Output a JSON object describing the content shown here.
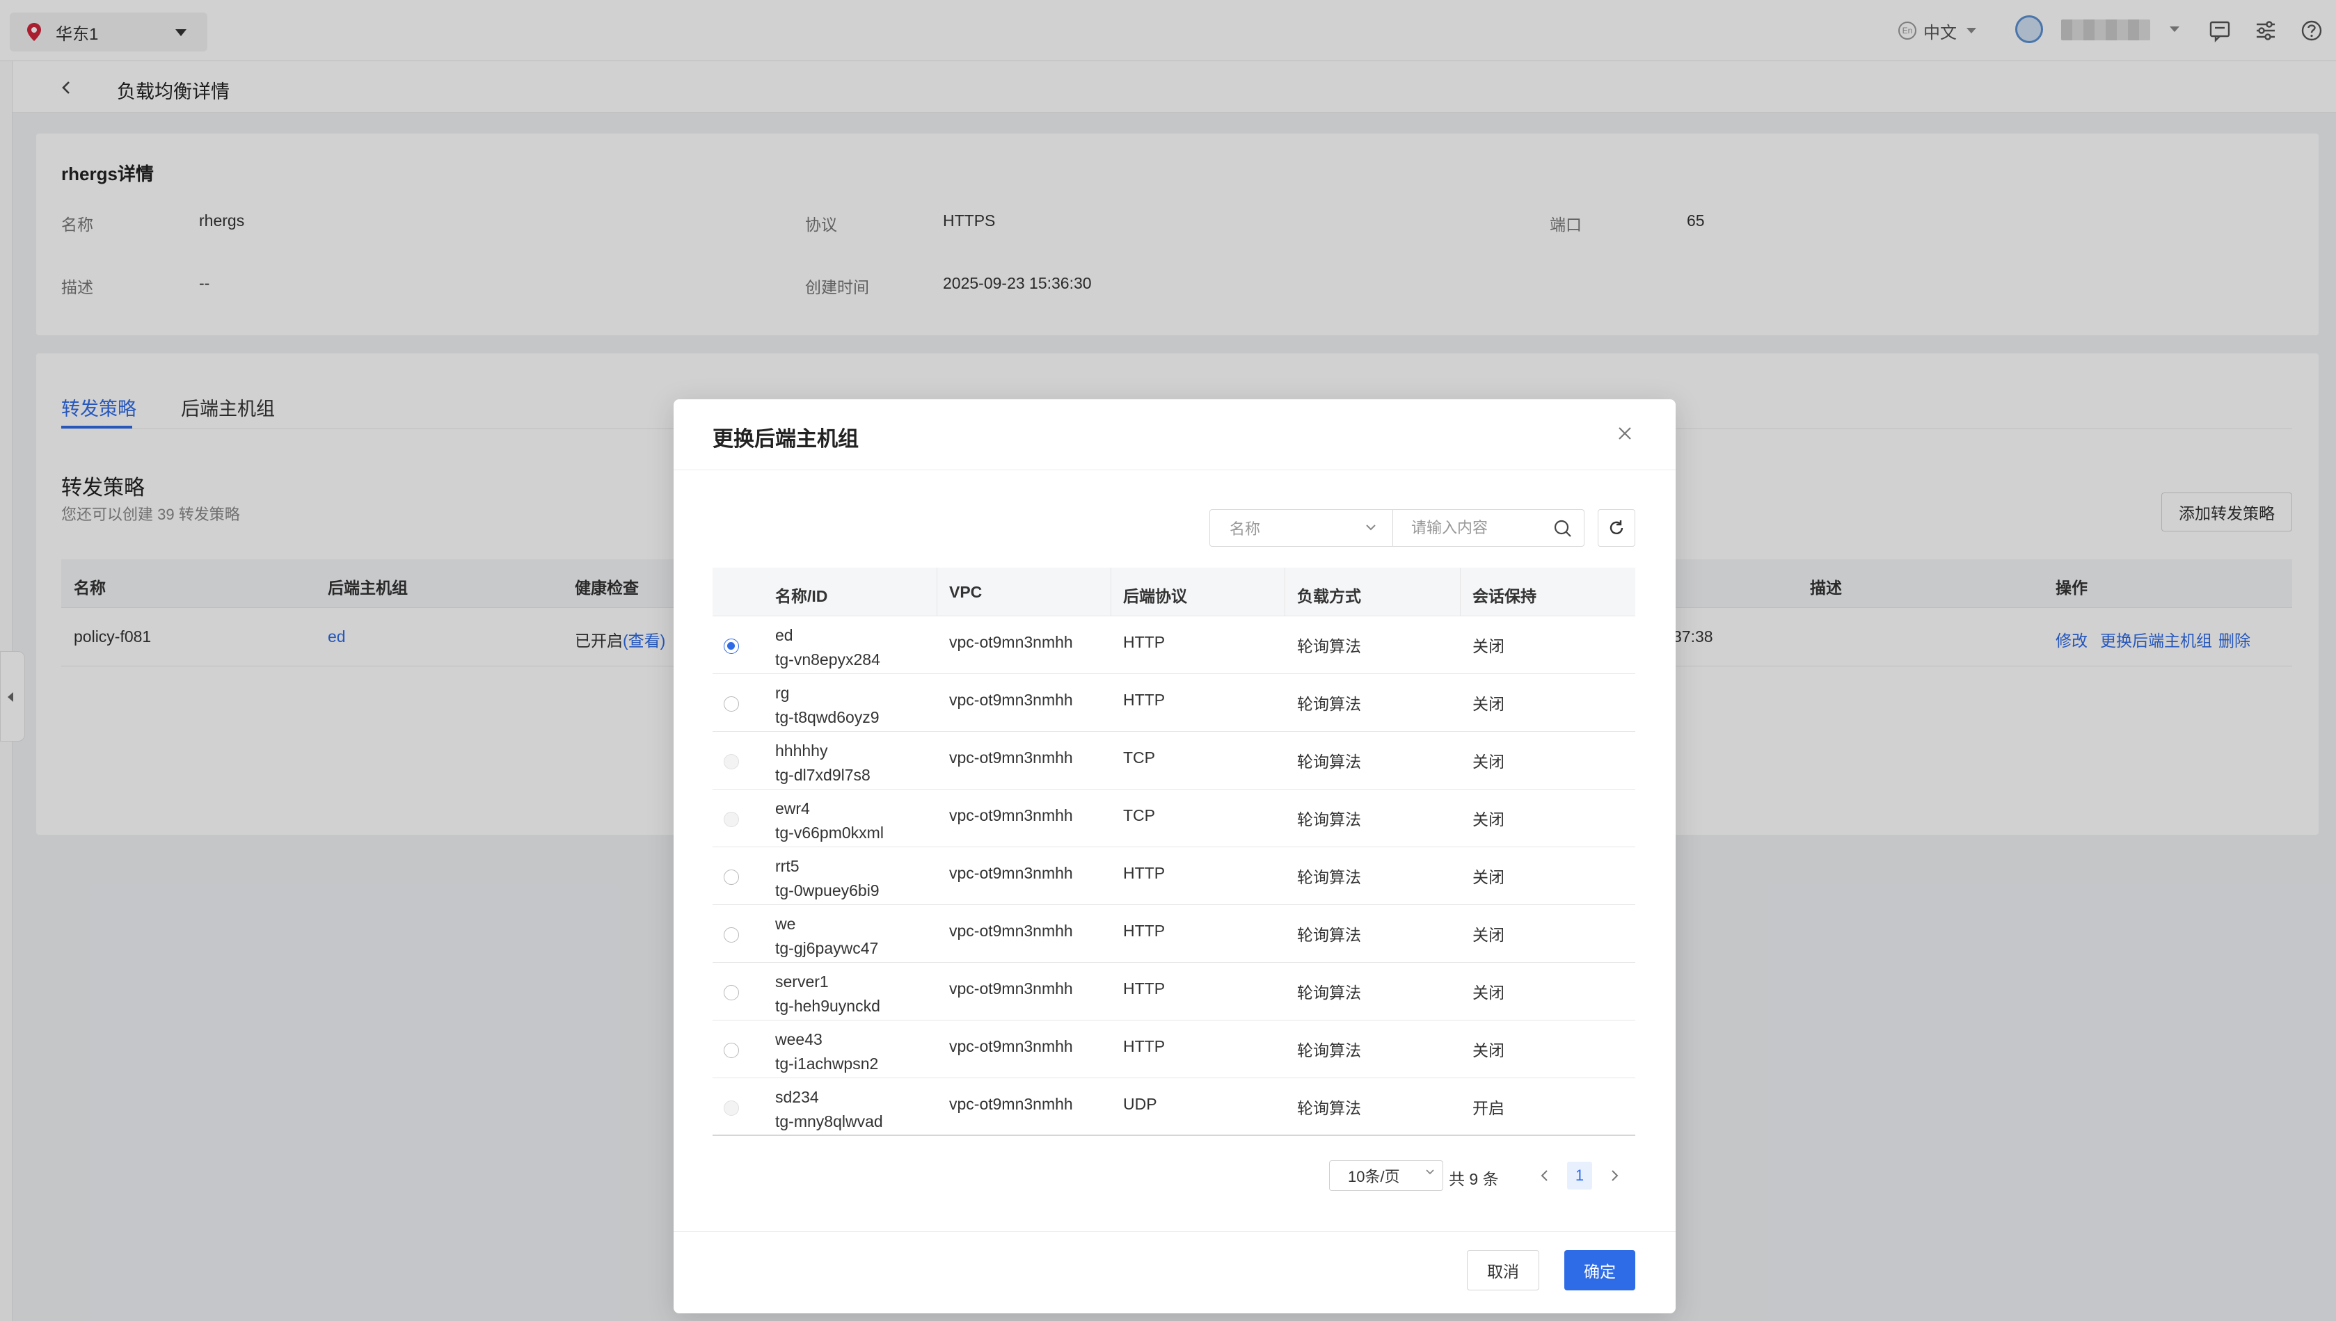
{
  "topbar": {
    "region": "华东1",
    "language": "中文",
    "lang_icon_text": "En"
  },
  "page": {
    "title": "负载均衡详情"
  },
  "detail": {
    "heading": "rhergs详情",
    "name_label": "名称",
    "name_value": "rhergs",
    "protocol_label": "协议",
    "protocol_value": "HTTPS",
    "port_label": "端口",
    "port_value": "65",
    "desc_label": "描述",
    "desc_value": "--",
    "created_label": "创建时间",
    "created_value": "2025-09-23 15:36:30"
  },
  "policy": {
    "tabs": [
      "转发策略",
      "后端主机组"
    ],
    "section_title": "转发策略",
    "section_sub": "您还可以创建 39 转发策略",
    "add_button": "添加转发策略",
    "columns": [
      "名称",
      "后端主机组",
      "健康检查",
      "描述",
      "操作"
    ],
    "row": {
      "name": "policy-f081",
      "group": "ed",
      "health": "已开启",
      "health_link": "(查看)",
      "time_fragment": "37:38",
      "actions": [
        "修改",
        "更换后端主机组",
        "删除"
      ]
    }
  },
  "modal": {
    "title": "更换后端主机组",
    "filter_select": "名称",
    "search_placeholder": "请输入内容",
    "columns": [
      "名称/ID",
      "VPC",
      "后端协议",
      "负载方式",
      "会话保持"
    ],
    "rows": [
      {
        "name": "ed",
        "id": "tg-vn8epyx284",
        "vpc": "vpc-ot9mn3nmhh",
        "protocol": "HTTP",
        "method": "轮询算法",
        "session": "关闭",
        "state": "checked"
      },
      {
        "name": "rg",
        "id": "tg-t8qwd6oyz9",
        "vpc": "vpc-ot9mn3nmhh",
        "protocol": "HTTP",
        "method": "轮询算法",
        "session": "关闭",
        "state": "normal"
      },
      {
        "name": "hhhhhy",
        "id": "tg-dl7xd9l7s8",
        "vpc": "vpc-ot9mn3nmhh",
        "protocol": "TCP",
        "method": "轮询算法",
        "session": "关闭",
        "state": "disabled"
      },
      {
        "name": "ewr4",
        "id": "tg-v66pm0kxml",
        "vpc": "vpc-ot9mn3nmhh",
        "protocol": "TCP",
        "method": "轮询算法",
        "session": "关闭",
        "state": "disabled"
      },
      {
        "name": "rrt5",
        "id": "tg-0wpuey6bi9",
        "vpc": "vpc-ot9mn3nmhh",
        "protocol": "HTTP",
        "method": "轮询算法",
        "session": "关闭",
        "state": "normal"
      },
      {
        "name": "we",
        "id": "tg-gj6paywc47",
        "vpc": "vpc-ot9mn3nmhh",
        "protocol": "HTTP",
        "method": "轮询算法",
        "session": "关闭",
        "state": "normal"
      },
      {
        "name": "server1",
        "id": "tg-heh9uynckd",
        "vpc": "vpc-ot9mn3nmhh",
        "protocol": "HTTP",
        "method": "轮询算法",
        "session": "关闭",
        "state": "normal"
      },
      {
        "name": "wee43",
        "id": "tg-i1achwpsn2",
        "vpc": "vpc-ot9mn3nmhh",
        "protocol": "HTTP",
        "method": "轮询算法",
        "session": "关闭",
        "state": "normal"
      },
      {
        "name": "sd234",
        "id": "tg-mny8qlwvad",
        "vpc": "vpc-ot9mn3nmhh",
        "protocol": "UDP",
        "method": "轮询算法",
        "session": "开启",
        "state": "disabled"
      }
    ],
    "page_size": "10条/页",
    "total": "共 9 条",
    "current_page": "1",
    "cancel": "取消",
    "confirm": "确定"
  },
  "colors": {
    "accent": "#2e6be6",
    "region_pin": "#d0263b"
  }
}
